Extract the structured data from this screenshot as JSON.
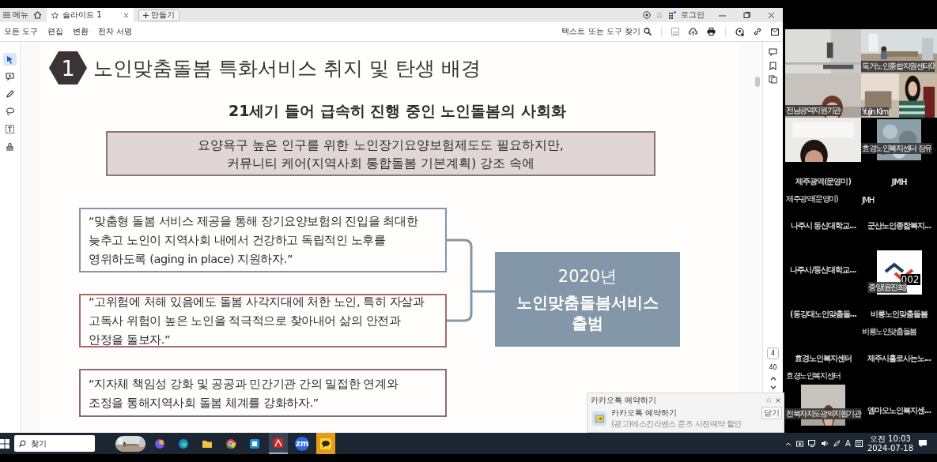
{
  "titlebar": {
    "menu": "메뉴",
    "tabs": [
      {
        "label": "슬라이드 1",
        "selected": true
      }
    ],
    "new_button": "만들기",
    "login": "로그인"
  },
  "toolbar": {
    "menus": [
      "모든 도구",
      "편집",
      "변환",
      "전자 서명"
    ],
    "search_label": "텍스트 또는 도구 찾기"
  },
  "left_tools": [
    {
      "selected": true
    },
    {
      "selected": false
    },
    {
      "selected": false
    },
    {
      "selected": false
    },
    {
      "selected": false
    },
    {
      "selected": false
    }
  ],
  "slide": {
    "number": "1",
    "title": "노인맞춤돌봄 특화서비스 취지 및 탄생 배경",
    "subtitle": "21세기 들어 급속히 진행 중인 노인돌봄의 사회화",
    "banner": [
      "요양욕구 높은 인구를 위한 노인장기요양보험제도도 필요하지만,",
      "커뮤니티 케어(지역사회 통합돌봄 기본계획) 강조 속에"
    ],
    "quotes": [
      {
        "lines": [
          "“맞춤형 돌봄 서비스 제공을 통해 장기요양보험의 진입을 최대한",
          "늦추고 노인이 지역사회 내에서 건강하고 독립적인 노후를",
          "영위하도록 (aging in place) 지원하자.”"
        ],
        "color": "#8096ab"
      },
      {
        "lines": [
          "“고위험에 처해 있음에도 돌봄 사각지대에 처한 노인, 특히 자살과",
          "고독사 위험이 높은 노인을 적극적으로 찾아내어 삶의 안전과",
          "안정을 돌보자.”"
        ],
        "color": "#a86a6e"
      },
      {
        "lines": [
          "“지자체 책임성 강화 및 공공과 민간기관 간의 밀접한 연계와",
          "조정을 통해지역사회 돌봄 체계를 강화하자.”"
        ],
        "color": "#8f6a70"
      }
    ],
    "result": {
      "year": "2020년",
      "lines": [
        "노인맞춤돌봄서비스",
        "출범"
      ]
    }
  },
  "page_nav": {
    "current": "4",
    "total": "40"
  },
  "participants": [
    {
      "kind": "video"
    },
    {
      "kind": "video",
      "label": "독거노인종합지원센터0"
    },
    {
      "kind": "video",
      "label": "전남광역지원기관"
    },
    {
      "kind": "video",
      "label": "Yujin Kim"
    },
    {
      "kind": "video"
    },
    {
      "kind": "video_small",
      "label": "효경노인복지센터 장유"
    },
    {
      "kind": "name",
      "name": "제주광역(문영미)",
      "label": "제주광역(문영미)"
    },
    {
      "kind": "name",
      "name": "JMH",
      "label": "JMH"
    },
    {
      "kind": "name",
      "name": "나주시 동신대학교..."
    },
    {
      "kind": "name",
      "name": "군산노인종합복지..."
    },
    {
      "kind": "name",
      "name": "나주시/동신대학교..."
    },
    {
      "kind": "logo",
      "badge": "002",
      "label": "중앙(윤진희)"
    },
    {
      "kind": "name",
      "name": "(동강대노인맞춤돌..."
    },
    {
      "kind": "name",
      "name": "비룡노인맞춤돌봄",
      "label": "비룡노인맞춤돌봄"
    },
    {
      "kind": "name",
      "name": "효경노인복지센터",
      "label": "효경노인복지센터"
    },
    {
      "kind": "name",
      "name": "제주시홀로사는노..."
    },
    {
      "kind": "video_small",
      "label": "전북자치도광역지원기관"
    },
    {
      "kind": "name",
      "name": "엠마오노인복지센..."
    }
  ],
  "notification": {
    "header": "카카오톡 예약하기",
    "title": "카카오톡 예약하기",
    "body": "(광고)에스킨라벤스 준조 사전예약 할인",
    "button": "닫기"
  },
  "taskbar": {
    "search": "찾기",
    "apps": [
      {
        "kind": "copilot",
        "selected": false
      },
      {
        "kind": "edge",
        "selected": false
      },
      {
        "kind": "folder",
        "selected": false
      },
      {
        "kind": "chrome",
        "selected": false
      },
      {
        "kind": "store",
        "selected": false
      },
      {
        "kind": "acrobat",
        "selected": true
      },
      {
        "kind": "zoom",
        "label": "zm",
        "selected": false
      },
      {
        "kind": "kakao",
        "selected": false
      }
    ],
    "ime": "A",
    "time": "오전 10:03",
    "date": "2024-07-18"
  }
}
